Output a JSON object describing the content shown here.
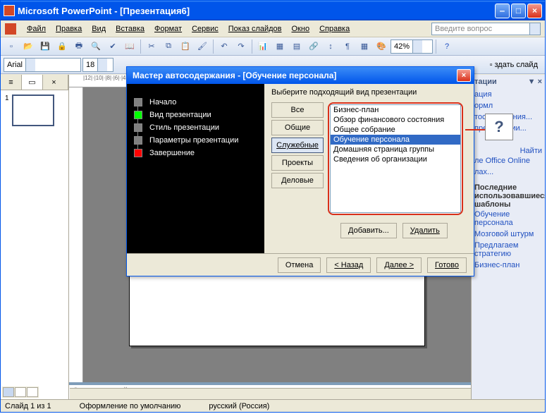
{
  "titlebar": {
    "title": "Microsoft PowerPoint - [Презентация6]"
  },
  "menu": {
    "file": "Файл",
    "edit": "Правка",
    "view": "Вид",
    "insert": "Вставка",
    "format": "Формат",
    "tools": "Сервис",
    "slideshow": "Показ слайдов",
    "window": "Окно",
    "help": "Справка"
  },
  "question_placeholder": "Введите вопрос",
  "font": {
    "name": "Arial",
    "size": "18"
  },
  "zoom": "42%",
  "new_slide_label": "здать слайд",
  "slide_num": "1",
  "notes_placeholder": "Заметки к слайду",
  "status": {
    "slide": "Слайд 1 из 1",
    "template": "Оформление по умолчанию",
    "lang": "русский (Россия)"
  },
  "taskpane": {
    "header": "тации",
    "links": {
      "a": "ация",
      "b": "ормл",
      "c": "тосодержания...",
      "d": "презентации..."
    },
    "find": "Найти",
    "online": "ле Office Online",
    "templates": "лах...",
    "recent_header": "Последние использовавшиеся шаблоны",
    "recent": [
      "Обучение персонала",
      "Мозговой штурм",
      "Предлагаем стратегию",
      "Бизнес-план"
    ]
  },
  "wizard": {
    "title": "Мастер автосодержания - [Обучение персонала]",
    "steps": {
      "start": "Начало",
      "type": "Вид презентации",
      "style": "Стиль презентации",
      "params": "Параметры презентации",
      "finish": "Завершение"
    },
    "prompt": "Выберите подходящий вид презентации",
    "cats": {
      "all": "Все",
      "general": "Общие",
      "business": "Служебные",
      "projects": "Проекты",
      "corp": "Деловые"
    },
    "templates": [
      "Бизнес-план",
      "Обзор финансового состояния",
      "Общее собрание",
      "Обучение персонала",
      "Домашняя страница группы",
      "Сведения об организации"
    ],
    "add": "Добавить...",
    "remove": "Удалить",
    "cancel": "Отмена",
    "back": "< Назад",
    "next": "Далее >",
    "finish_btn": "Готово"
  },
  "callout": "?"
}
